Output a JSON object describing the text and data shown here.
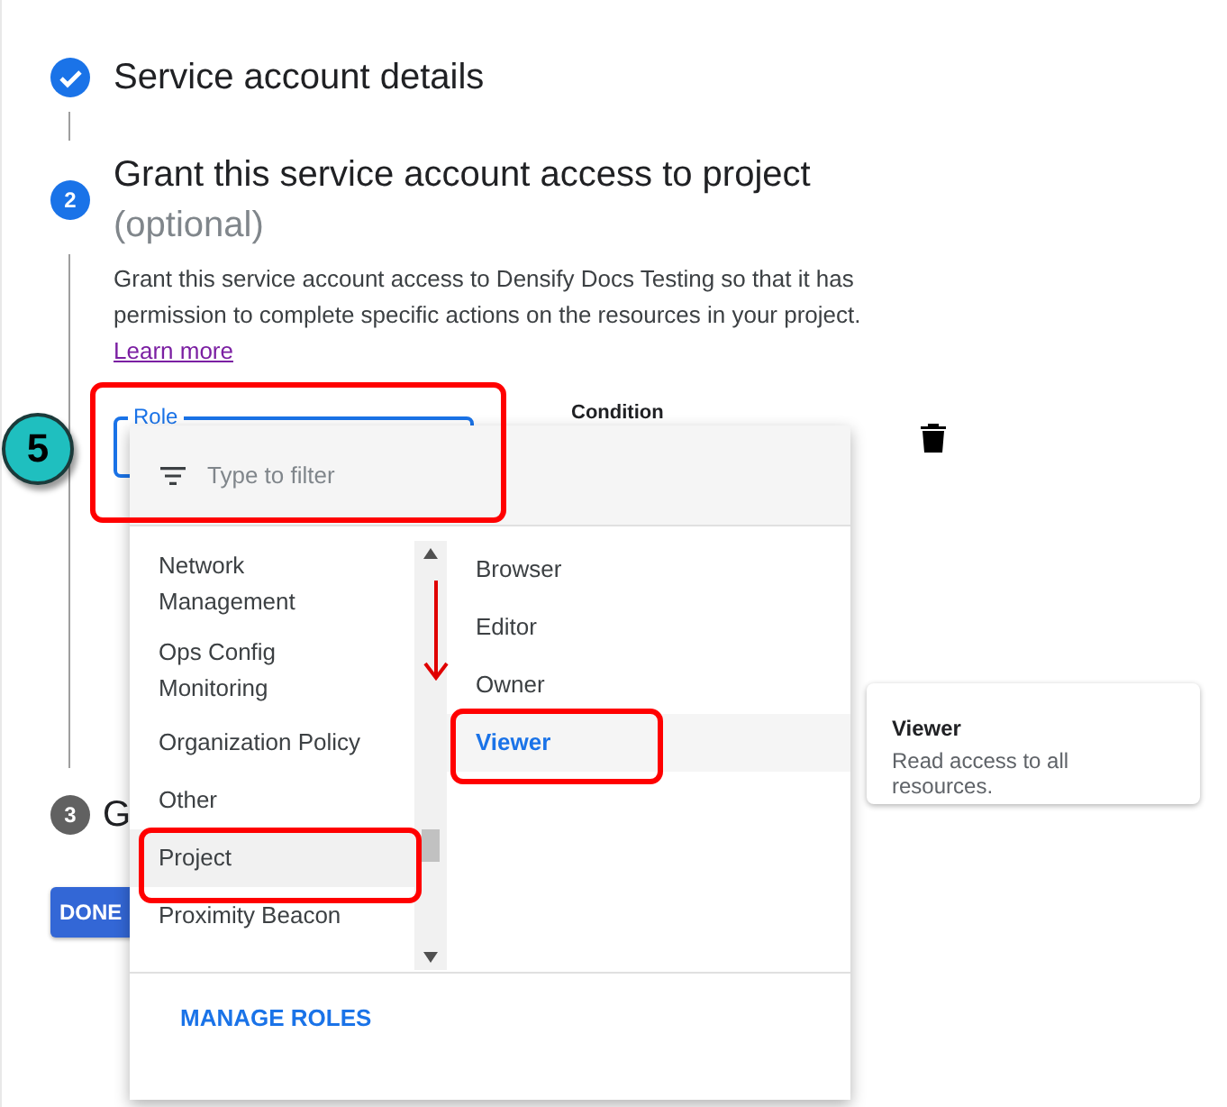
{
  "steps": [
    {
      "completed": true,
      "title": "Service account details"
    },
    {
      "completed": false,
      "active": true,
      "number": "2",
      "title": "Grant this service account access to project",
      "subtitle": "(optional)"
    },
    {
      "completed": false,
      "active": false,
      "number": "3",
      "title": "G"
    }
  ],
  "description": {
    "text": "Grant this service account access to Densify Docs Testing so that it has permission to complete specific actions on the resources in your project.",
    "link": "Learn more"
  },
  "role_field": {
    "label": "Role",
    "focused": true
  },
  "condition_label": "Condition",
  "done_button": "DONE",
  "role_dropdown": {
    "filter": {
      "placeholder": "Type to filter"
    },
    "categories": [
      {
        "label": "Network Management",
        "selected": false
      },
      {
        "label": "Ops Config Monitoring",
        "selected": false
      },
      {
        "label": "Organization Policy",
        "selected": false
      },
      {
        "label": "Other",
        "selected": false
      },
      {
        "label": "Project",
        "selected": true
      },
      {
        "label": "Proximity Beacon",
        "selected": false
      }
    ],
    "roles": [
      {
        "label": "Browser",
        "selected": false
      },
      {
        "label": "Editor",
        "selected": false
      },
      {
        "label": "Owner",
        "selected": false
      },
      {
        "label": "Viewer",
        "selected": true
      }
    ],
    "footer_button": "MANAGE ROLES"
  },
  "role_tooltip": {
    "title": "Viewer",
    "description": "Read access to all resources."
  },
  "step_badge": "5"
}
